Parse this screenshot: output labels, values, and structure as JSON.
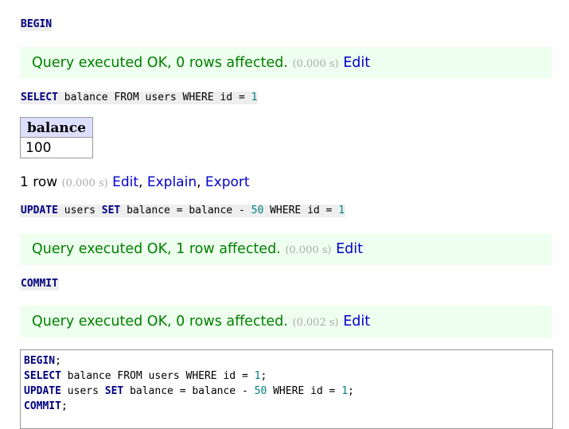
{
  "statements": {
    "begin": "BEGIN",
    "select": {
      "kw1": "SELECT",
      "text": " balance FROM users WHERE id = ",
      "num": "1"
    },
    "update": {
      "kw1": "UPDATE",
      "mid1": " users ",
      "kw2": "SET",
      "mid2": " balance = balance - ",
      "num": "50",
      "mid3": " WHERE id = ",
      "num2": "1"
    },
    "commit": "COMMIT"
  },
  "messages": [
    {
      "text": "Query executed OK, 0 rows affected.",
      "time": "(0.000 s)",
      "edit": "Edit"
    },
    {
      "text": "Query executed OK, 1 row affected.",
      "time": "(0.000 s)",
      "edit": "Edit"
    },
    {
      "text": "Query executed OK, 0 rows affected.",
      "time": "(0.002 s)",
      "edit": "Edit"
    }
  ],
  "result": {
    "columns": [
      "balance"
    ],
    "rows": [
      [
        "100"
      ]
    ],
    "rowcount": "1 row",
    "time": "(0.000 s)",
    "links": [
      "Edit",
      "Explain",
      "Export"
    ]
  },
  "editor": {
    "line1": {
      "kw": "BEGIN",
      "rest": ";"
    },
    "line2": {
      "kw": "SELECT",
      "text": " balance FROM users WHERE id = ",
      "num": "1",
      "end": ";"
    },
    "line3": {
      "kw1": "UPDATE",
      "mid1": " users ",
      "kw2": "SET",
      "mid2": " balance = balance - ",
      "num": "50",
      "mid3": " WHERE id = ",
      "num2": "1",
      "end": ";"
    },
    "line4": {
      "kw": "COMMIT",
      "rest": ";"
    }
  }
}
